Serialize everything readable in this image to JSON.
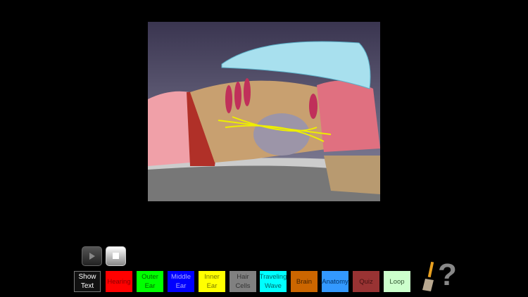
{
  "controls": {
    "play_icon": "play-icon",
    "stop_icon": "stop-icon"
  },
  "buttons": [
    {
      "label": "Show Text",
      "bg": "#111111",
      "fg": "#ffffff"
    },
    {
      "label": "Hearing",
      "bg": "#ff0000",
      "fg": "#880000"
    },
    {
      "label": "Outer Ear",
      "bg": "#00ff00",
      "fg": "#006600"
    },
    {
      "label": "Middle Ear",
      "bg": "#0000ff",
      "fg": "#aaaaff"
    },
    {
      "label": "Inner Ear",
      "bg": "#ffff00",
      "fg": "#777700"
    },
    {
      "label": "Hair Cells",
      "bg": "#808080",
      "fg": "#333333"
    },
    {
      "label": "Traveling Wave",
      "bg": "#00ffff",
      "fg": "#006666"
    },
    {
      "label": "Brain",
      "bg": "#cc6600",
      "fg": "#442200"
    },
    {
      "label": "Anatomy",
      "bg": "#3399ff",
      "fg": "#003366"
    },
    {
      "label": "Quiz",
      "bg": "#993333",
      "fg": "#441111"
    },
    {
      "label": "Loop",
      "bg": "#ccffcc",
      "fg": "#335533"
    }
  ],
  "tools": {
    "paint_icon": "paintbrush-icon",
    "help_label": "?"
  }
}
